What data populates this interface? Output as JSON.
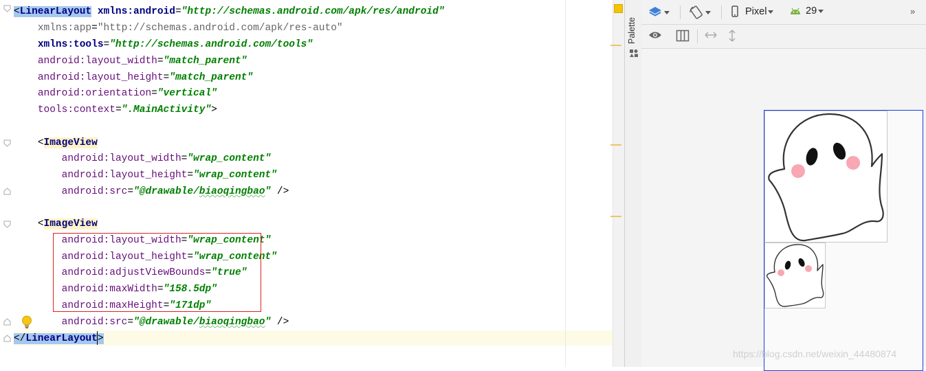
{
  "editor": {
    "lines": [
      {
        "id": "l1",
        "parts": [
          [
            "sel",
            "<"
          ],
          [
            "tagsel",
            "LinearLayout"
          ],
          [
            "sp",
            " "
          ],
          [
            "attrb",
            "xmlns:android"
          ],
          [
            "punc",
            "="
          ],
          [
            "val",
            "\"http://schemas.android.com/apk/res/android\""
          ]
        ]
      },
      {
        "id": "l2",
        "parts": [
          [
            "sp",
            "    "
          ],
          [
            "attrg",
            "xmlns:app"
          ],
          [
            "punc",
            "="
          ],
          [
            "valg",
            "\"http://schemas.android.com/apk/res-auto\""
          ]
        ]
      },
      {
        "id": "l3",
        "parts": [
          [
            "sp",
            "    "
          ],
          [
            "attrb",
            "xmlns:tools"
          ],
          [
            "punc",
            "="
          ],
          [
            "val",
            "\"http://schemas.android.com/tools\""
          ]
        ]
      },
      {
        "id": "l4",
        "parts": [
          [
            "sp",
            "    "
          ],
          [
            "attr",
            "android:layout_width"
          ],
          [
            "punc",
            "="
          ],
          [
            "val",
            "\"match_parent\""
          ]
        ]
      },
      {
        "id": "l5",
        "parts": [
          [
            "sp",
            "    "
          ],
          [
            "attr",
            "android:layout_height"
          ],
          [
            "punc",
            "="
          ],
          [
            "val",
            "\"match_parent\""
          ]
        ]
      },
      {
        "id": "l6",
        "parts": [
          [
            "sp",
            "    "
          ],
          [
            "attr",
            "android:orientation"
          ],
          [
            "punc",
            "="
          ],
          [
            "val",
            "\"vertical\""
          ]
        ]
      },
      {
        "id": "l7",
        "parts": [
          [
            "sp",
            "    "
          ],
          [
            "attr",
            "tools:context"
          ],
          [
            "punc",
            "="
          ],
          [
            "val",
            "\".MainActivity\""
          ],
          [
            "punc",
            ">"
          ]
        ]
      },
      {
        "id": "l8",
        "parts": []
      },
      {
        "id": "l9",
        "parts": [
          [
            "sp",
            "    "
          ],
          [
            "punc",
            "<"
          ],
          [
            "tagh",
            "ImageView"
          ]
        ]
      },
      {
        "id": "l10",
        "parts": [
          [
            "sp",
            "        "
          ],
          [
            "attr",
            "android:layout_width"
          ],
          [
            "punc",
            "="
          ],
          [
            "val",
            "\"wrap_content\""
          ]
        ]
      },
      {
        "id": "l11",
        "parts": [
          [
            "sp",
            "        "
          ],
          [
            "attr",
            "android:layout_height"
          ],
          [
            "punc",
            "="
          ],
          [
            "val",
            "\"wrap_content\""
          ]
        ]
      },
      {
        "id": "l12",
        "parts": [
          [
            "sp",
            "        "
          ],
          [
            "attr",
            "android:src"
          ],
          [
            "punc",
            "="
          ],
          [
            "val",
            "\"@drawable/"
          ],
          [
            "valsq",
            "biaoqingbao"
          ],
          [
            "val",
            "\""
          ],
          [
            "punc",
            " />"
          ]
        ]
      },
      {
        "id": "l13",
        "parts": []
      },
      {
        "id": "l14",
        "parts": [
          [
            "sp",
            "    "
          ],
          [
            "punc",
            "<"
          ],
          [
            "tagh",
            "ImageView"
          ]
        ]
      },
      {
        "id": "l15",
        "parts": [
          [
            "sp",
            "        "
          ],
          [
            "attr",
            "android:layout_width"
          ],
          [
            "punc",
            "="
          ],
          [
            "val",
            "\"wrap_content\""
          ]
        ]
      },
      {
        "id": "l16",
        "parts": [
          [
            "sp",
            "        "
          ],
          [
            "attr",
            "android:layout_height"
          ],
          [
            "punc",
            "="
          ],
          [
            "val",
            "\"wrap_content\""
          ]
        ]
      },
      {
        "id": "l17",
        "parts": [
          [
            "sp",
            "        "
          ],
          [
            "attr",
            "android:adjustViewBounds"
          ],
          [
            "punc",
            "="
          ],
          [
            "val",
            "\"true\""
          ]
        ]
      },
      {
        "id": "l18",
        "parts": [
          [
            "sp",
            "        "
          ],
          [
            "attr",
            "android:maxWidth"
          ],
          [
            "punc",
            "="
          ],
          [
            "val",
            "\"158.5dp\""
          ]
        ]
      },
      {
        "id": "l19",
        "parts": [
          [
            "sp",
            "        "
          ],
          [
            "attr",
            "android:maxHeight"
          ],
          [
            "punc",
            "="
          ],
          [
            "val",
            "\"171dp\""
          ]
        ]
      },
      {
        "id": "l20",
        "parts": [
          [
            "sp",
            "        "
          ],
          [
            "attr",
            "android:src"
          ],
          [
            "punc",
            "="
          ],
          [
            "val",
            "\"@drawable/"
          ],
          [
            "valsq",
            "biaoqingbao"
          ],
          [
            "val",
            "\""
          ],
          [
            "punc",
            " />"
          ]
        ]
      },
      {
        "id": "l21",
        "parts": [
          [
            "sel",
            "</"
          ],
          [
            "tagsel",
            "LinearLayout"
          ],
          [
            "sel",
            ">"
          ]
        ]
      }
    ]
  },
  "palette": {
    "label": "Palette"
  },
  "toolbar": {
    "device": "Pixel",
    "api": "29"
  },
  "watermark": "https://blog.csdn.net/weixin_44480874",
  "colors": {
    "accent": "#1a3ce6",
    "selection": "#a6c8f0",
    "red_box": "#dd2222"
  }
}
